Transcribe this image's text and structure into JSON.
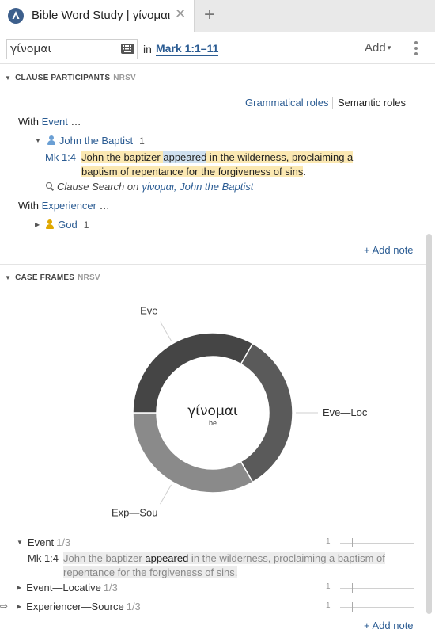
{
  "tab": {
    "title": "Bible Word Study | γίνομαι",
    "close_glyph": "✕",
    "add_glyph": "+"
  },
  "toolbar": {
    "search_value": "γίνομαι",
    "in_label": "in",
    "passage": "Mark 1:1–11",
    "add_label": "Add",
    "add_caret": "▾"
  },
  "clause_participants": {
    "caret": "▼",
    "title": "CLAUSE PARTICIPANTS",
    "version": "NRSV",
    "roles": {
      "grammatical": "Grammatical roles",
      "semantic": "Semantic roles"
    },
    "event": {
      "with_label": "With",
      "role": "Event",
      "ellipsis": "…",
      "participant": {
        "caret": "▼",
        "name": "John the Baptist",
        "count": "1",
        "icon_color": "#6a9fd4"
      },
      "verse": {
        "ref": "Mk 1:4",
        "text_before": "John the baptizer ",
        "text_highlight": "appeared",
        "text_after": " in the wilderness, proclaiming a baptism of repentance for the forgiveness of sins",
        "end": "."
      },
      "clause_search": {
        "label": "Clause Search on",
        "terms": "γίνομαι, John the Baptist"
      }
    },
    "experiencer": {
      "with_label": "With",
      "role": "Experiencer",
      "ellipsis": "…",
      "participant": {
        "caret": "▶",
        "name": "God",
        "count": "1",
        "icon_color": "#e0a800"
      }
    },
    "add_note": "+ Add note"
  },
  "case_frames": {
    "caret": "▼",
    "title": "CASE FRAMES",
    "version": "NRSV",
    "donut": {
      "center_word": "γίνομαι",
      "center_gloss": "be",
      "segments": [
        {
          "label": "Eve—Loc",
          "share": 0.3333,
          "color": "#5a5a5a"
        },
        {
          "label": "Exp—Sou",
          "share": 0.3333,
          "color": "#8a8a8a"
        },
        {
          "label": "Eve",
          "share": 0.3333,
          "color": "#454545"
        }
      ]
    },
    "rows": [
      {
        "caret": "▼",
        "label": "Event",
        "fraction": "1/3",
        "count": "1",
        "verse": {
          "ref": "Mk 1:4",
          "before": "John the baptizer ",
          "strong": "appeared",
          "after": " in the wilderness, proclaiming a baptism of repentance for the forgiveness of sins."
        }
      },
      {
        "caret": "▶",
        "label": "Event—Locative",
        "fraction": "1/3",
        "count": "1"
      },
      {
        "caret": "▶",
        "label": "Experiencer—Source",
        "fraction": "1/3",
        "count": "1"
      }
    ],
    "add_note": "+ Add note"
  },
  "colors": {
    "link": "#2b5c93",
    "highlight": "#fbe8b2",
    "selected": "#cfe0ef"
  },
  "icons": {
    "app": "logos-app-icon",
    "keyboard": "keyboard-icon",
    "more": "kebab-icon",
    "search": "magnifier-icon",
    "pointer": "arrow-pointer-icon"
  },
  "pointer_glyph": "⇨"
}
